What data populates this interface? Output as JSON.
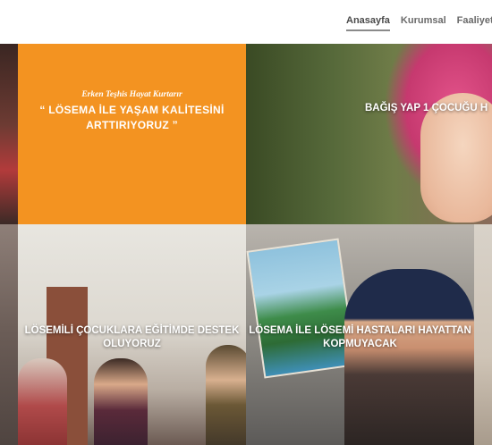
{
  "nav": {
    "items": [
      {
        "label": "Anasayfa",
        "active": true
      },
      {
        "label": "Kurumsal",
        "active": false
      },
      {
        "label": "Faaliyetler",
        "active": false
      }
    ]
  },
  "tiles": {
    "awareness": {
      "subtitle": "Erken Teşhis Hayat Kurtarır",
      "quote": "“ LÖSEMA İLE YAŞAM KALİTESİNİ ARTTIRIYORUZ ”",
      "color": "#f39321"
    },
    "donate": {
      "caption": "BAĞIŞ YAP 1 ÇOCUĞU H"
    },
    "education": {
      "caption": "LÖSEMİLİ ÇOCUKLARA EĞİTİMDE DESTEK OLUYORUZ"
    },
    "painting": {
      "caption": "LÖSEMA İLE LÖSEMİ HASTALARI HAYATTAN KOPMUYACAK"
    }
  }
}
